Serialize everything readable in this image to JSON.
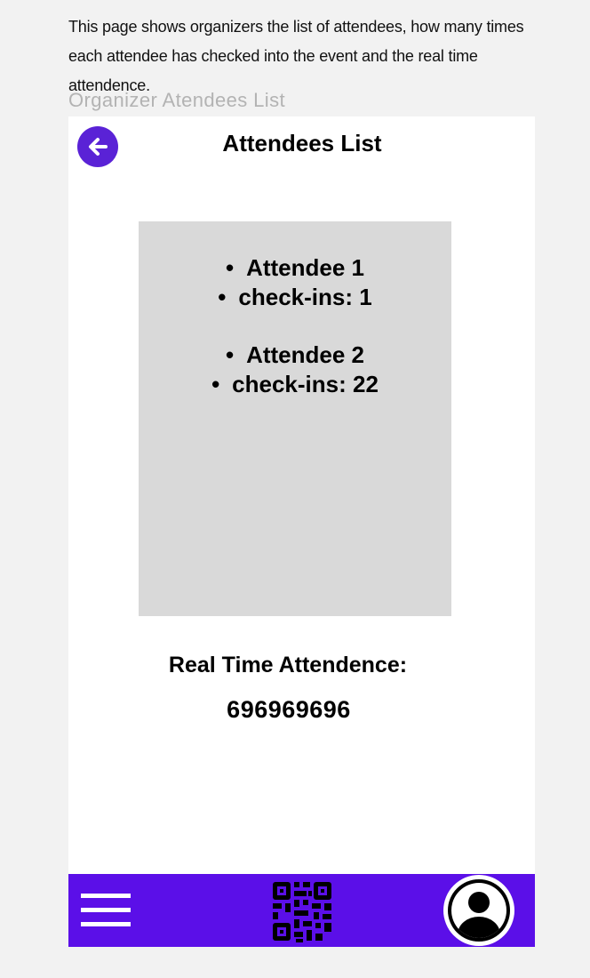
{
  "description": "This page shows organizers the list of attendees, how many times each attendee has checked into the event and the real time attendence.",
  "frame_label": "Organizer Atendees List",
  "header": {
    "title": "Attendees List",
    "back_icon": "arrow-left-icon"
  },
  "attendees": [
    {
      "name": "Attendee 1",
      "checkins": "check-ins: 1"
    },
    {
      "name": "Attendee 2",
      "checkins": "check-ins: 22"
    }
  ],
  "real_time": {
    "label": "Real Time Attendence:",
    "value": "696969696"
  },
  "navbar": {
    "menu_icon": "hamburger-menu-icon",
    "qr_icon": "qr-code-icon",
    "profile_icon": "user-profile-icon"
  },
  "colors": {
    "accent": "#5a22d6",
    "navbar": "#5b0fe8",
    "list_bg": "#d9d9d9",
    "page_bg": "#f2f2f2"
  }
}
